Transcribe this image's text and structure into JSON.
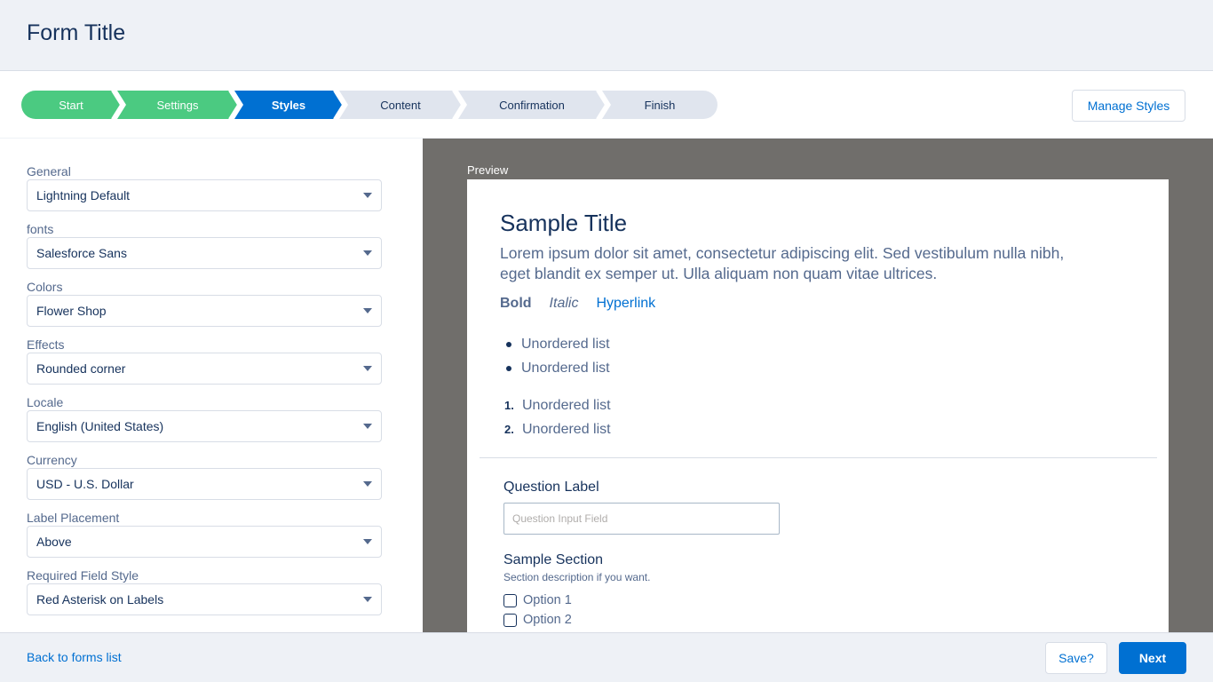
{
  "header": {
    "title": "Form Title"
  },
  "path": {
    "steps": [
      {
        "label": "Start",
        "state": "done"
      },
      {
        "label": "Settings",
        "state": "done"
      },
      {
        "label": "Styles",
        "state": "current"
      },
      {
        "label": "Content",
        "state": "todo"
      },
      {
        "label": "Confirmation",
        "state": "todo"
      },
      {
        "label": "Finish",
        "state": "todo"
      }
    ]
  },
  "colors": {
    "done": "#4bca81",
    "current": "#0070d2",
    "todo": "#e0e5ee"
  },
  "toolbar": {
    "manage_styles_label": "Manage Styles"
  },
  "settings": {
    "fields": [
      {
        "label": "General",
        "value": "Lightning Default"
      },
      {
        "label": "fonts",
        "value": "Salesforce Sans"
      },
      {
        "label": "Colors",
        "value": "Flower Shop"
      },
      {
        "label": "Effects",
        "value": "Rounded corner"
      },
      {
        "label": "Locale",
        "value": "English (United States)"
      },
      {
        "label": "Currency",
        "value": "USD - U.S. Dollar"
      },
      {
        "label": "Label Placement",
        "value": "Above"
      },
      {
        "label": "Required Field Style",
        "value": "Red Asterisk on Labels"
      }
    ]
  },
  "preview": {
    "label": "Preview",
    "sample_title": "Sample Title",
    "lorem": "Lorem ipsum dolor sit amet, consectetur adipiscing elit. Sed vestibulum nulla nibh, eget blandit ex semper ut. Ulla aliquam non quam vitae ultrices.",
    "bold": "Bold",
    "italic": "Italic",
    "hyperlink": "Hyperlink",
    "unordered": [
      "Unordered list",
      "Unordered list"
    ],
    "ordered": [
      "Unordered list",
      "Unordered list"
    ],
    "ordered_nums": [
      "1.",
      "2."
    ],
    "question_label": "Question Label",
    "question_placeholder": "Question Input Field",
    "section_title": "Sample Section",
    "section_desc": "Section description if you want.",
    "options": [
      "Option 1",
      "Option 2"
    ]
  },
  "footer": {
    "back_label": "Back to forms list",
    "save_label": "Save?",
    "next_label": "Next"
  }
}
